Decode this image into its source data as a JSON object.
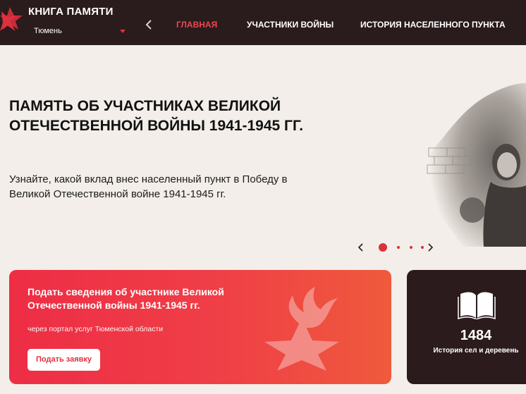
{
  "header": {
    "title": "КНИГА ПАМЯТИ",
    "city": "Тюмень",
    "nav": [
      {
        "label": "ГЛАВНАЯ",
        "active": true
      },
      {
        "label": "УЧАСТНИКИ ВОЙНЫ",
        "active": false
      },
      {
        "label": "ИСТОРИЯ НАСЕЛЕННОГО ПУНКТА",
        "active": false
      }
    ]
  },
  "hero": {
    "title": "ПАМЯТЬ ОБ УЧАСТНИКАХ ВЕЛИКОЙ ОТЕЧЕСТВЕННОЙ ВОЙНЫ 1941-1945 ГГ.",
    "subtitle": "Узнайте, какой вклад внес населенный пункт в Победу в Великой Отечественной войне 1941-1945 гг.",
    "slider": {
      "slides": 4,
      "active_slide": 1
    }
  },
  "submit_card": {
    "title": "Подать сведения об участнике Великой Отечественной войны 1941-1945 гг.",
    "subtitle": "через портал услуг Тюменской области",
    "button": "Подать заявку"
  },
  "stats_card": {
    "number": "1484",
    "label": "История сел и деревень",
    "icon": "open-book-icon"
  },
  "colors": {
    "header_bg": "#2a1b1c",
    "accent": "#ef4650",
    "page_bg": "#f3eee9",
    "card_red": "#ee2d45",
    "card_dark": "#2b1b1d"
  }
}
